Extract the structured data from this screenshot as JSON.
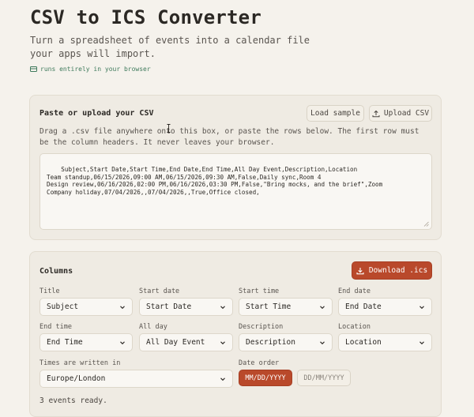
{
  "header": {
    "title": "CSV to ICS Converter",
    "subtitle": "Turn a spreadsheet of events into a calendar file your apps will import.",
    "badge": "runs entirely in your browser"
  },
  "input_card": {
    "title": "Paste or upload your CSV",
    "load_sample_label": "Load sample",
    "upload_label": "Upload CSV",
    "hint": "Drag a .csv file anywhere onto this box, or paste the rows below. The first row must be the column headers. It never leaves your browser.",
    "csv_text": "Subject,Start Date,Start Time,End Date,End Time,All Day Event,Description,Location\nTeam standup,06/15/2026,09:00 AM,06/15/2026,09:30 AM,False,Daily sync,Room 4\nDesign review,06/16/2026,02:00 PM,06/16/2026,03:30 PM,False,\"Bring mocks, and the brief\",Zoom\nCompany holiday,07/04/2026,,07/04/2026,,True,Office closed,"
  },
  "columns_card": {
    "title": "Columns",
    "download_label": "Download .ics",
    "fields": [
      {
        "label": "Title",
        "value": "Subject"
      },
      {
        "label": "Start date",
        "value": "Start Date"
      },
      {
        "label": "Start time",
        "value": "Start Time"
      },
      {
        "label": "End date",
        "value": "End Date"
      },
      {
        "label": "End time",
        "value": "End Time"
      },
      {
        "label": "All day",
        "value": "All Day Event"
      },
      {
        "label": "Description",
        "value": "Description"
      },
      {
        "label": "Location",
        "value": "Location"
      }
    ],
    "timezone": {
      "label": "Times are written in",
      "value": "Europe/London"
    },
    "date_order": {
      "label": "Date order",
      "options": [
        "MM/DD/YYYY",
        "DD/MM/YYYY"
      ],
      "selected": "MM/DD/YYYY"
    },
    "status": "3 events ready."
  },
  "colors": {
    "accent": "#b9492b",
    "badge_green": "#3f7a5c",
    "background": "#f5f2ec"
  }
}
